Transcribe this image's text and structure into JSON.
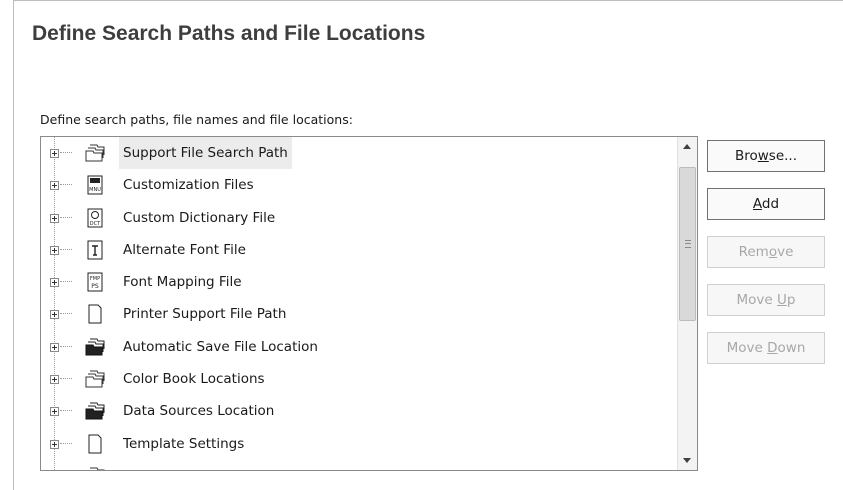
{
  "dialog": {
    "title": "Define Search Paths and File Locations",
    "instruction": "Define search paths, file names and file locations:"
  },
  "tree": {
    "items": [
      {
        "label": "Support File Search Path",
        "icon": "folder-stack-icon",
        "selected": true
      },
      {
        "label": "Customization Files",
        "icon": "mnu-file-icon"
      },
      {
        "label": "Custom Dictionary File",
        "icon": "dct-file-icon"
      },
      {
        "label": "Alternate Font File",
        "icon": "font-file-icon"
      },
      {
        "label": "Font Mapping File",
        "icon": "fmp-ps-file-icon"
      },
      {
        "label": "Printer Support File Path",
        "icon": "document-icon"
      },
      {
        "label": "Automatic Save File Location",
        "icon": "folder-stack-icon"
      },
      {
        "label": "Color Book Locations",
        "icon": "folder-stack-icon"
      },
      {
        "label": "Data Sources Location",
        "icon": "folder-stack-icon"
      },
      {
        "label": "Template Settings",
        "icon": "document-icon"
      }
    ],
    "icon_labels": {
      "mnu": "MNU",
      "dct": "DCT",
      "ps": "PS",
      "fmp": "FMP"
    }
  },
  "buttons": {
    "browse": {
      "pre": "Bro",
      "key": "w",
      "post": "se...",
      "enabled": true
    },
    "add": {
      "pre": "",
      "key": "A",
      "post": "dd",
      "enabled": true
    },
    "remove": {
      "pre": "Rem",
      "key": "o",
      "post": "ve",
      "enabled": false
    },
    "move_up": {
      "pre": "Move ",
      "key": "U",
      "post": "p",
      "enabled": false
    },
    "move_down": {
      "pre": "Move ",
      "key": "D",
      "post": "own",
      "enabled": false
    }
  },
  "colors": {
    "title_text": "#3e3e3e",
    "selected_row": "#ececec",
    "disabled_text": "#a8a8a8"
  }
}
